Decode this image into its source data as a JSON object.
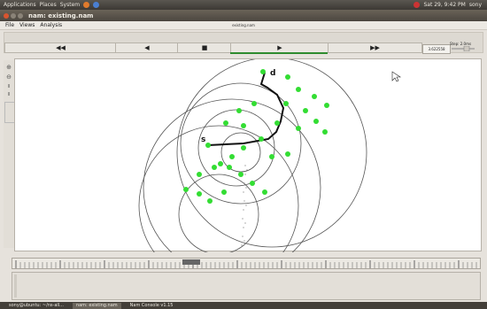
{
  "top_panel": {
    "menus": [
      "Applications",
      "Places",
      "System"
    ],
    "status": "Sat  29, 9:42 PM",
    "user": "sony"
  },
  "window": {
    "title": "nam: existing.nam"
  },
  "menu_bar": {
    "file": "File",
    "views": "Views",
    "analysis": "Analysis",
    "center_title": "existing.nam"
  },
  "toolbar": {
    "rewind": "◀◀",
    "back": "◀",
    "stop": "■",
    "play": "▶",
    "fast_forward": "▶▶",
    "sim_time": "3.622558",
    "step_label": "Step: 2.0ms"
  },
  "left_tools": [
    "⊕",
    "⊖",
    "II",
    "II"
  ],
  "network": {
    "label_source": "s",
    "label_dest": "d",
    "node_color": "#33dd33",
    "path_color": "#111111"
  },
  "taskbar": {
    "tasks": [
      "sony@ubuntu: ~/ns-all...",
      "nam: existing.nam",
      "Nam Console v1.15"
    ]
  }
}
